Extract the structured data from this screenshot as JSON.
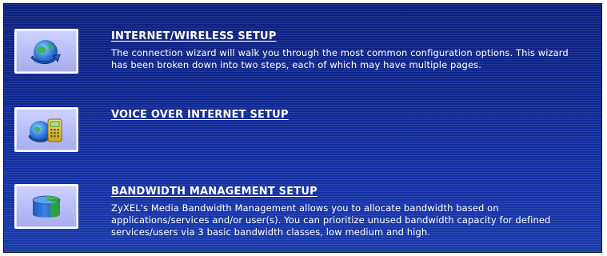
{
  "wizard": {
    "items": [
      {
        "title": "INTERNET/WIRELESS SETUP",
        "description": "The connection wizard will walk you through the most common configuration options. This wizard has been broken down into two steps, each of which may have multiple pages.",
        "icon": "globe-arrow-icon"
      },
      {
        "title": "VOICE OVER INTERNET SETUP",
        "description": "",
        "icon": "globe-phone-icon"
      },
      {
        "title": "BANDWIDTH MANAGEMENT SETUP",
        "description": "ZyXEL's Media Bandwidth Management allows you to allocate bandwidth based on applications/services and/or user(s). You can prioritize unused bandwidth capacity for defined services/users via 3 basic bandwidth classes, low medium and high.",
        "icon": "bandwidth-cylinder-icon"
      }
    ]
  },
  "colors": {
    "background_top": "#0b1f7a",
    "background_bottom": "#183aa8",
    "text": "#ffffff",
    "icon_box": "#b8bcf7"
  }
}
